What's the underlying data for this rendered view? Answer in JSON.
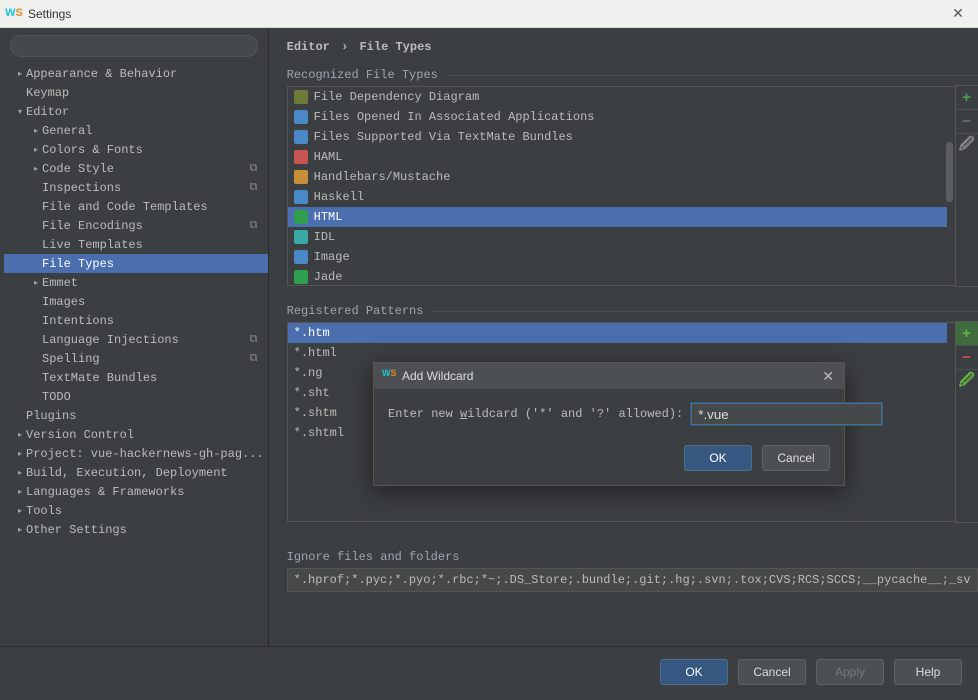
{
  "window": {
    "title": "Settings"
  },
  "search": {
    "placeholder": ""
  },
  "sidebar": {
    "items": [
      {
        "label": "Appearance & Behavior",
        "indent": 0,
        "arrow": "closed"
      },
      {
        "label": "Keymap",
        "indent": 0
      },
      {
        "label": "Editor",
        "indent": 0,
        "arrow": "open"
      },
      {
        "label": "General",
        "indent": 1,
        "arrow": "closed"
      },
      {
        "label": "Colors & Fonts",
        "indent": 1,
        "arrow": "closed"
      },
      {
        "label": "Code Style",
        "indent": 1,
        "arrow": "closed",
        "copy": true
      },
      {
        "label": "Inspections",
        "indent": 1,
        "copy": true
      },
      {
        "label": "File and Code Templates",
        "indent": 1
      },
      {
        "label": "File Encodings",
        "indent": 1,
        "copy": true
      },
      {
        "label": "Live Templates",
        "indent": 1
      },
      {
        "label": "File Types",
        "indent": 1,
        "selected": true
      },
      {
        "label": "Emmet",
        "indent": 1,
        "arrow": "closed"
      },
      {
        "label": "Images",
        "indent": 1
      },
      {
        "label": "Intentions",
        "indent": 1
      },
      {
        "label": "Language Injections",
        "indent": 1,
        "copy": true
      },
      {
        "label": "Spelling",
        "indent": 1,
        "copy": true
      },
      {
        "label": "TextMate Bundles",
        "indent": 1
      },
      {
        "label": "TODO",
        "indent": 1
      },
      {
        "label": "Plugins",
        "indent": 0
      },
      {
        "label": "Version Control",
        "indent": 0,
        "arrow": "closed"
      },
      {
        "label": "Project: vue-hackernews-gh-pag...",
        "indent": 0,
        "arrow": "closed"
      },
      {
        "label": "Build, Execution, Deployment",
        "indent": 0,
        "arrow": "closed"
      },
      {
        "label": "Languages & Frameworks",
        "indent": 0,
        "arrow": "closed"
      },
      {
        "label": "Tools",
        "indent": 0,
        "arrow": "closed"
      },
      {
        "label": "Other Settings",
        "indent": 0,
        "arrow": "closed"
      }
    ]
  },
  "breadcrumb": {
    "editor": "Editor",
    "sep": "›",
    "page": "File Types"
  },
  "sections": {
    "recognized": "Recognized File Types",
    "patterns": "Registered Patterns",
    "ignore": "Ignore files and folders"
  },
  "file_types": [
    {
      "label": "File Dependency Diagram",
      "chip": "generic"
    },
    {
      "label": "Files Opened In Associated Applications",
      "chip": "blue"
    },
    {
      "label": "Files Supported Via TextMate Bundles",
      "chip": "blue"
    },
    {
      "label": "HAML",
      "chip": "doc"
    },
    {
      "label": "Handlebars/Mustache",
      "chip": "orange"
    },
    {
      "label": "Haskell",
      "chip": "blue"
    },
    {
      "label": "HTML",
      "chip": "html",
      "selected": true
    },
    {
      "label": "IDL",
      "chip": "teal"
    },
    {
      "label": "Image",
      "chip": "blue"
    },
    {
      "label": "Jade",
      "chip": "html"
    }
  ],
  "file_types_toolbox": {
    "add_color": "#499c54",
    "remove_color": "#6e6e6e",
    "edit_color": "#888888"
  },
  "patterns": [
    {
      "label": "*.htm",
      "selected": true
    },
    {
      "label": "*.html"
    },
    {
      "label": "*.ng"
    },
    {
      "label": "*.sht"
    },
    {
      "label": "*.shtm"
    },
    {
      "label": "*.shtml"
    }
  ],
  "patterns_toolbox": {
    "add_color": "#62b543",
    "remove_color": "#c75450",
    "edit_color": "#62b543"
  },
  "ignore_value": "*.hprof;*.pyc;*.pyo;*.rbc;*~;.DS_Store;.bundle;.git;.hg;.svn;.tox;CVS;RCS;SCCS;__pycache__;_sv",
  "buttons": {
    "ok": "OK",
    "cancel": "Cancel",
    "apply": "Apply",
    "help": "Help"
  },
  "modal": {
    "title": "Add Wildcard",
    "prompt_pre": "Enter new ",
    "prompt_u": "w",
    "prompt_post": "ildcard ('*' and '?' allowed):",
    "value": "*.vue",
    "ok": "OK",
    "cancel": "Cancel"
  }
}
